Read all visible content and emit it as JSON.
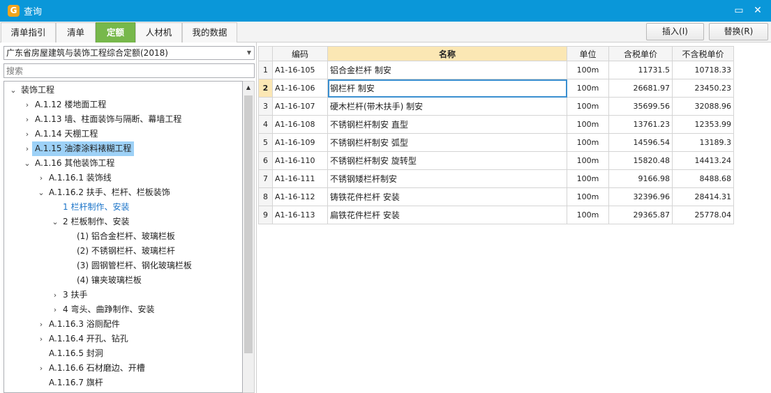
{
  "window": {
    "title": "查询",
    "app_icon": "app-logo-icon",
    "controls": [
      "restore-icon",
      "close-icon"
    ]
  },
  "tabs": [
    {
      "label": "清单指引",
      "active": false
    },
    {
      "label": "清单",
      "active": false
    },
    {
      "label": "定额",
      "active": true
    },
    {
      "label": "人材机",
      "active": false
    },
    {
      "label": "我的数据",
      "active": false
    }
  ],
  "actions": {
    "insert": "插入(I)",
    "replace": "替换(R)"
  },
  "left_panel": {
    "quota_select": "广东省房屋建筑与装饰工程综合定额(2018)",
    "search_placeholder": "搜索",
    "tree": [
      {
        "label": "装饰工程",
        "chev": "down",
        "indent": 0
      },
      {
        "label": "A.1.12 楼地面工程",
        "chev": "right",
        "indent": 1
      },
      {
        "label": "A.1.13 墙、柱面装饰与隔断、幕墙工程",
        "chev": "right",
        "indent": 1
      },
      {
        "label": "A.1.14 天棚工程",
        "chev": "right",
        "indent": 1
      },
      {
        "label": "A.1.15 油漆涂料裱糊工程",
        "chev": "right",
        "indent": 1,
        "selected": true
      },
      {
        "label": "A.1.16 其他装饰工程",
        "chev": "down",
        "indent": 1
      },
      {
        "label": "A.1.16.1 装饰线",
        "chev": "right",
        "indent": 2
      },
      {
        "label": "A.1.16.2 扶手、栏杆、栏板装饰",
        "chev": "down",
        "indent": 2
      },
      {
        "label": "1 栏杆制作、安装",
        "chev": "",
        "indent": 3,
        "link": true
      },
      {
        "label": "2 栏板制作、安装",
        "chev": "down",
        "indent": 3
      },
      {
        "label": "(1) 铝合金栏杆、玻璃栏板",
        "chev": "",
        "indent": 4
      },
      {
        "label": "(2) 不锈钢栏杆、玻璃栏杆",
        "chev": "",
        "indent": 4
      },
      {
        "label": "(3) 圆钢管栏杆、钢化玻璃栏板",
        "chev": "",
        "indent": 4
      },
      {
        "label": "(4) 镶夹玻璃栏板",
        "chev": "",
        "indent": 4
      },
      {
        "label": "3 扶手",
        "chev": "right",
        "indent": 3
      },
      {
        "label": "4 弯头、曲踭制作、安装",
        "chev": "right",
        "indent": 3
      },
      {
        "label": "A.1.16.3 浴厕配件",
        "chev": "right",
        "indent": 2
      },
      {
        "label": "A.1.16.4 开孔、钻孔",
        "chev": "right",
        "indent": 2
      },
      {
        "label": "A.1.16.5 封洞",
        "chev": "",
        "indent": 2
      },
      {
        "label": "A.1.16.6 石材磨边、开槽",
        "chev": "right",
        "indent": 2
      },
      {
        "label": "A.1.16.7 旗杆",
        "chev": "",
        "indent": 2
      }
    ]
  },
  "grid": {
    "headers": [
      "",
      "编码",
      "名称",
      "单位",
      "含税单价",
      "不含税单价"
    ],
    "rows": [
      [
        "1",
        "A1-16-105",
        "铝合金栏杆 制安",
        "100m",
        "11731.5",
        "10718.33"
      ],
      [
        "2",
        "A1-16-106",
        "钢栏杆 制安",
        "100m",
        "26681.97",
        "23450.23"
      ],
      [
        "3",
        "A1-16-107",
        "硬木栏杆(带木扶手) 制安",
        "100m",
        "35699.56",
        "32088.96"
      ],
      [
        "4",
        "A1-16-108",
        "不锈钢栏杆制安 直型",
        "100m",
        "13761.23",
        "12353.99"
      ],
      [
        "5",
        "A1-16-109",
        "不锈钢栏杆制安 弧型",
        "100m",
        "14596.54",
        "13189.3"
      ],
      [
        "6",
        "A1-16-110",
        "不锈钢栏杆制安 旋转型",
        "100m",
        "15820.48",
        "14413.24"
      ],
      [
        "7",
        "A1-16-111",
        "不锈钢矮栏杆制安",
        "100m",
        "9166.98",
        "8488.68"
      ],
      [
        "8",
        "A1-16-112",
        "铸铁花件栏杆 安装",
        "100m",
        "32396.96",
        "28414.31"
      ],
      [
        "9",
        "A1-16-113",
        "扁铁花件栏杆 安装",
        "100m",
        "29365.87",
        "25778.04"
      ]
    ],
    "current_row": 2
  },
  "colors": {
    "titlebar": "#0a97d9",
    "active_tab": "#77b84b",
    "selection": "#9dd1f7",
    "header_highlight": "#fbe7b4",
    "link": "#1a73c8"
  }
}
